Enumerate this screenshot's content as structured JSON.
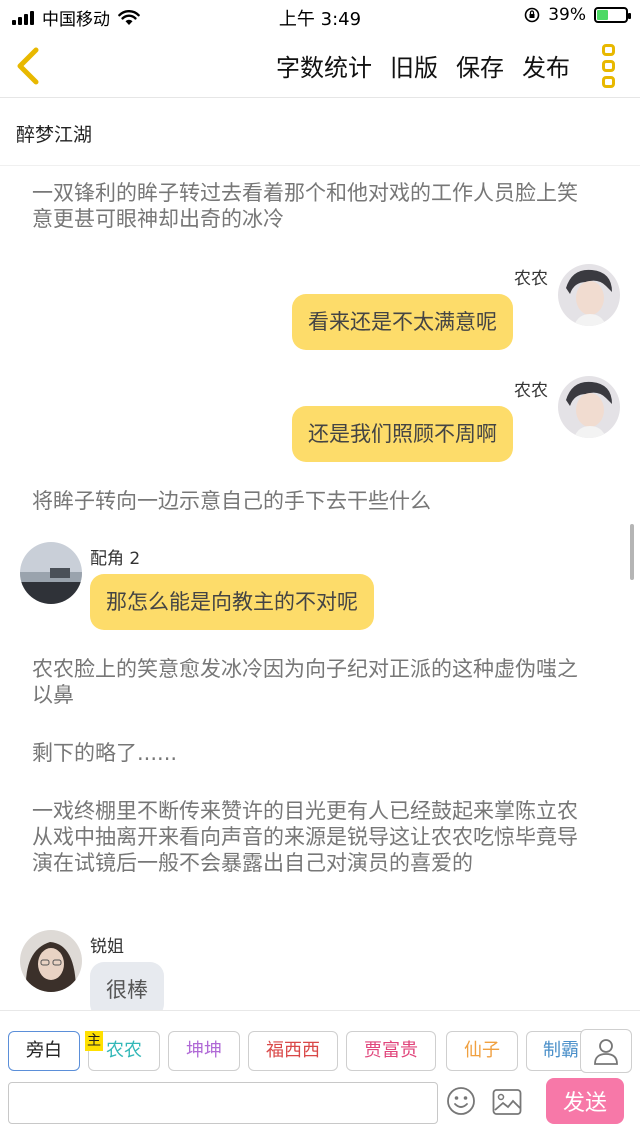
{
  "status_bar": {
    "carrier": "中国移动",
    "time": "上午 3:49",
    "battery": "39%",
    "battery_level": 0.39
  },
  "nav": {
    "actions": [
      "字数统计",
      "旧版",
      "保存",
      "发布"
    ]
  },
  "title": "醉梦江湖",
  "messages": [
    {
      "type": "narration",
      "text": "一双锋利的眸子转过去看着那个和他对戏的工作人员脸上笑意更甚可眼神却出奇的冰冷"
    },
    {
      "type": "right",
      "name": "农农",
      "text": "看来还是不太满意呢"
    },
    {
      "type": "right",
      "name": "农农",
      "text": "还是我们照顾不周啊"
    },
    {
      "type": "narration",
      "text": "将眸子转向一边示意自己的手下去干些什么"
    },
    {
      "type": "left",
      "name": "配角 2",
      "text": "那怎么能是向教主的不对呢"
    },
    {
      "type": "narration",
      "text": "农农脸上的笑意愈发冰冷因为向子纪对正派的这种虚伪嗤之以鼻"
    },
    {
      "type": "narration",
      "text": "剩下的略了......"
    },
    {
      "type": "narration",
      "text": "一戏终棚里不断传来赞许的目光更有人已经鼓起来掌陈立农从戏中抽离开来看向声音的来源是锐导这让农农吃惊毕竟导演在试镜后一般不会暴露出自己对演员的喜爱的"
    },
    {
      "type": "left",
      "name": "锐姐",
      "text": "很棒"
    }
  ],
  "roles": {
    "main_tag": "主",
    "chips": [
      {
        "label": "旁白",
        "color": "#222222"
      },
      {
        "label": "农农",
        "color": "#33b8b8"
      },
      {
        "label": "坤坤",
        "color": "#b069d6"
      },
      {
        "label": "福西西",
        "color": "#d94848"
      },
      {
        "label": "贾富贵",
        "color": "#e0457b"
      },
      {
        "label": "仙子",
        "color": "#f0a040"
      },
      {
        "label": "制霸",
        "color": "#4a8fc9"
      }
    ]
  },
  "input": {
    "placeholder": "",
    "send_label": "发送"
  },
  "colors": {
    "accent": "#e8b800",
    "bubble": "#fddc6a",
    "send": "#f778a8"
  }
}
